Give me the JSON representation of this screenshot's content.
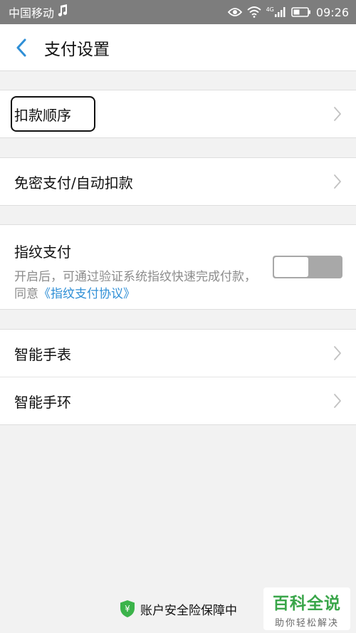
{
  "status_bar": {
    "carrier": "中国移动",
    "network": "4G",
    "time": "09:26"
  },
  "header": {
    "title": "支付设置"
  },
  "sections": {
    "deduction_order": {
      "label": "扣款顺序"
    },
    "password_free": {
      "label": "免密支付/自动扣款"
    },
    "fingerprint": {
      "title": "指纹支付",
      "desc_prefix": "开启后，可通过验证系统指纹快速完成付款，同意",
      "desc_link": "《指纹支付协议》",
      "enabled": false
    },
    "smart_watch": {
      "label": "智能手表"
    },
    "smart_band": {
      "label": "智能手环"
    }
  },
  "footer": {
    "text": "账户安全险保障中"
  },
  "watermark": {
    "title": "百科全说",
    "subtitle": "助你轻松解决"
  },
  "colors": {
    "accent": "#2f8fd6",
    "shield": "#3bb34a",
    "status_bar": "#7d7d7d"
  },
  "icons": [
    "back-arrow-icon",
    "chevron-right-icon",
    "shield-icon",
    "music-note-icon",
    "eye-icon",
    "wifi-icon",
    "signal-icon",
    "battery-icon"
  ]
}
